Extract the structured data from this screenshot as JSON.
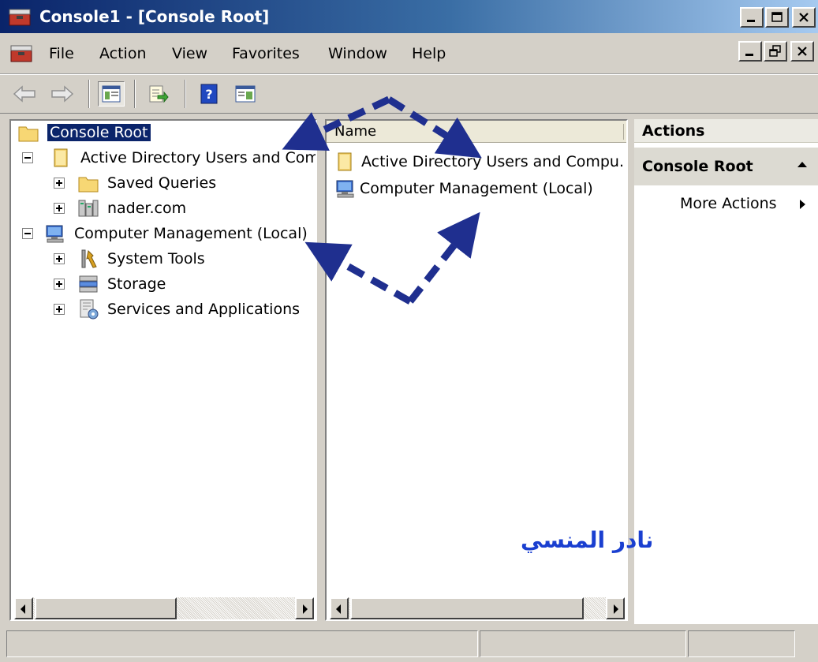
{
  "window": {
    "title": "Console1 - [Console Root]"
  },
  "menu": [
    "File",
    "Action",
    "View",
    "Favorites",
    "Window",
    "Help"
  ],
  "tree": {
    "root": "Console Root",
    "items": [
      {
        "label": "Active Directory Users and Com",
        "level": 1,
        "expander": "minus",
        "icon": "ad-folder-icon"
      },
      {
        "label": "Saved Queries",
        "level": 2,
        "expander": "plus",
        "icon": "folder-icon"
      },
      {
        "label": "nader.com",
        "level": 2,
        "expander": "plus",
        "icon": "domain-icon"
      },
      {
        "label": "Computer Management (Local)",
        "level": 1,
        "expander": "minus",
        "icon": "computer-management-icon"
      },
      {
        "label": "System Tools",
        "level": 2,
        "expander": "plus",
        "icon": "tools-icon"
      },
      {
        "label": "Storage",
        "level": 2,
        "expander": "plus",
        "icon": "storage-icon"
      },
      {
        "label": "Services and Applications",
        "level": 2,
        "expander": "plus",
        "icon": "services-icon"
      }
    ]
  },
  "list": {
    "column_name": "Name",
    "items": [
      {
        "label": "Active Directory Users and Compu.",
        "icon": "ad-folder-icon"
      },
      {
        "label": "Computer Management (Local)",
        "icon": "computer-management-icon"
      }
    ]
  },
  "actions": {
    "header": "Actions",
    "group": "Console Root",
    "items": [
      "More Actions"
    ]
  },
  "annotation": {
    "watermark": "نادر المنسي",
    "arrow_color": "#1f2f8f"
  }
}
